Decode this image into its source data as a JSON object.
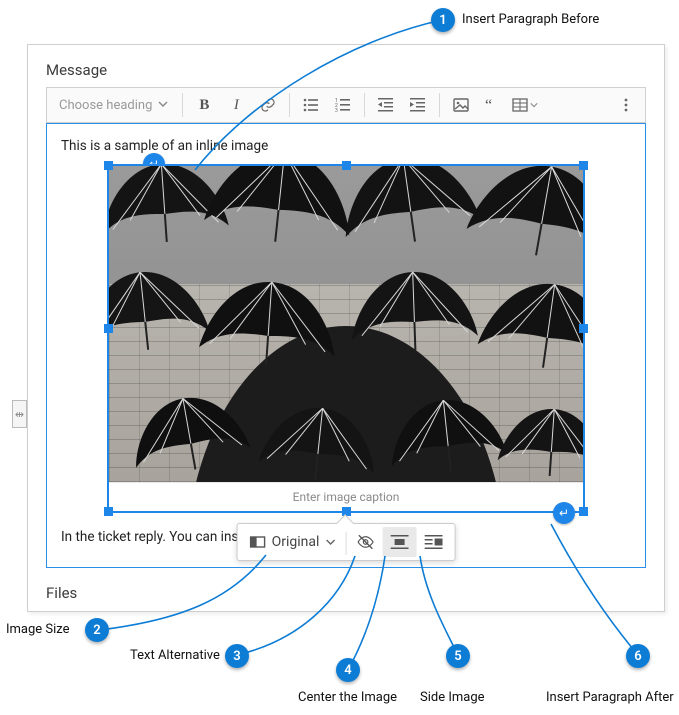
{
  "labels": {
    "message": "Message",
    "files": "Files"
  },
  "toolbar": {
    "heading_placeholder": "Choose heading"
  },
  "editor": {
    "line1": "This is a sample of an inline image",
    "line2": "In the ticket reply.  You can ins",
    "caption_placeholder": "Enter image caption"
  },
  "balloon": {
    "size_label": "Original"
  },
  "callouts": {
    "c1": {
      "num": "1",
      "text": "Insert Paragraph Before"
    },
    "c2": {
      "num": "2",
      "text": "Image Size"
    },
    "c3": {
      "num": "3",
      "text": "Text Alternative"
    },
    "c4": {
      "num": "4",
      "text": "Center the Image"
    },
    "c5": {
      "num": "5",
      "text": "Side Image"
    },
    "c6": {
      "num": "6",
      "text": "Insert Paragraph After"
    }
  }
}
